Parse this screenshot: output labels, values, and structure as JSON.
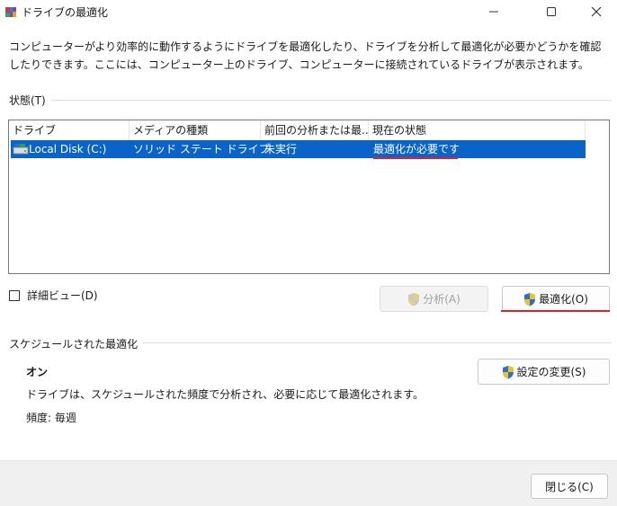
{
  "window": {
    "title": "ドライブの最適化",
    "minimize_icon": "minimize-icon",
    "maximize_icon": "maximize-icon",
    "close_icon": "close-icon"
  },
  "description": "コンピューターがより効率的に動作するようにドライブを最適化したり、ドライブを分析して最適化が必要かどうかを確認したりできます。ここには、コンピューター上のドライブ、コンピューターに接続されているドライブが表示されます。",
  "status_section": {
    "label": "状態(T)",
    "columns": [
      "ドライブ",
      "メディアの種類",
      "前回の分析または最...",
      "現在の状態"
    ],
    "rows": [
      {
        "drive": "Local Disk (C:)",
        "media": "ソリッド ステート ドライブ",
        "last": "未実行",
        "status": "最適化が必要です",
        "icon": "disk-icon"
      }
    ],
    "accent": "#0a63c9",
    "annotation_color": "#e0202a"
  },
  "detail_view": {
    "label": "詳細ビュー(D)",
    "checked": false
  },
  "buttons": {
    "analyze": "分析(A)",
    "optimize": "最適化(O)",
    "change_settings": "設定の変更(S)",
    "close": "閉じる(C)"
  },
  "schedule": {
    "label": "スケジュールされた最適化",
    "status": "オン",
    "description": "ドライブは、スケジュールされた頻度で分析され、必要に応じて最適化されます。",
    "frequency": "頻度: 毎週"
  }
}
